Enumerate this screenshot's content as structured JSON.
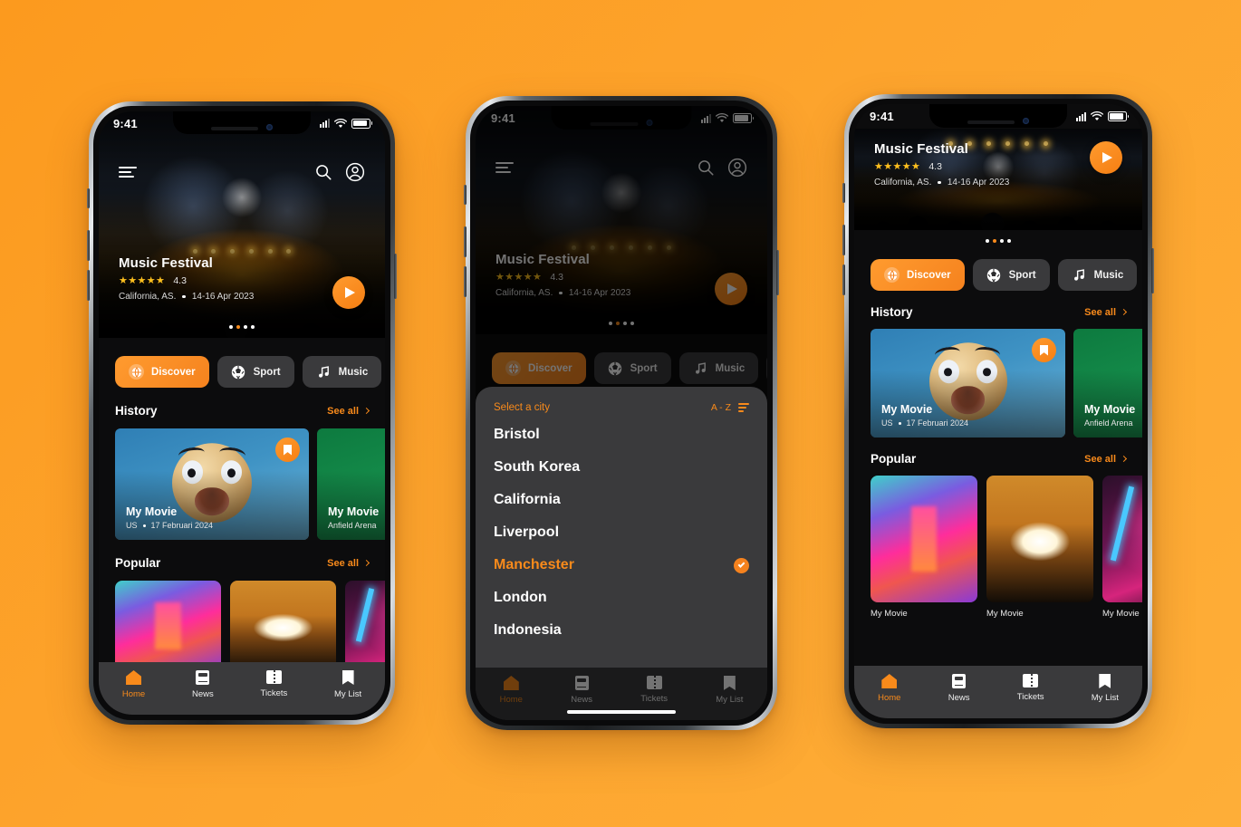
{
  "background": {
    "color_start": "#FC9A1E",
    "color_end": "#FEAE38"
  },
  "theme": {
    "accent": "#F88A1B",
    "surface": "#3A3A3C",
    "screen_bg": "#0C0C0D"
  },
  "status_bar": {
    "time": "9:41"
  },
  "header": {
    "menu_icon": "hamburger-menu-icon",
    "search_icon": "search-icon",
    "account_icon": "account-avatar-icon"
  },
  "hero": {
    "title": "Music Festival",
    "stars": "★★★★★",
    "rating": "4.3",
    "location": "California, AS.",
    "date": "14-16 Apr 2023",
    "play_icon": "play-icon",
    "pagination_count": 4,
    "pagination_active_index": 1
  },
  "chips": [
    {
      "label": "Discover",
      "icon": "globe-icon",
      "active": true
    },
    {
      "label": "Sport",
      "icon": "soccer-ball-icon",
      "active": false
    },
    {
      "label": "Music",
      "icon": "music-note-icon",
      "active": false
    },
    {
      "label": "",
      "icon": "ticket-icon",
      "active": false
    }
  ],
  "sections": [
    {
      "title": "History",
      "see_all": "See all",
      "cards": [
        {
          "title": "My Movie",
          "country": "US",
          "date": "17 Februari 2024",
          "bookmarked": true,
          "art": "shocked-face"
        },
        {
          "title": "My Movie",
          "venue": "Anfield Arena",
          "bookmarked": false,
          "art": "green"
        }
      ]
    },
    {
      "title": "Popular",
      "see_all": "See all",
      "cards": [
        {
          "name": "My Movie",
          "art": "neon-corridor"
        },
        {
          "name": "My Movie",
          "art": "cinema-hall"
        },
        {
          "name": "My Movie",
          "art": "concert-stage"
        }
      ]
    }
  ],
  "tab_bar": {
    "items": [
      {
        "label": "Home",
        "icon": "home-icon",
        "active": true
      },
      {
        "label": "News",
        "icon": "news-icon",
        "active": false
      },
      {
        "label": "Tickets",
        "icon": "ticket-icon",
        "active": false
      },
      {
        "label": "My List",
        "icon": "bookmark-icon",
        "active": false
      }
    ]
  },
  "city_sheet": {
    "title": "Select a city",
    "sort_label": "A - Z",
    "sort_icon": "sort-filter-icon",
    "cities": [
      {
        "name": "Bristol",
        "selected": false
      },
      {
        "name": "South Korea",
        "selected": false
      },
      {
        "name": "California",
        "selected": false
      },
      {
        "name": "Liverpool",
        "selected": false
      },
      {
        "name": "Manchester",
        "selected": true
      },
      {
        "name": "London",
        "selected": false
      },
      {
        "name": "Indonesia",
        "selected": false
      }
    ]
  }
}
